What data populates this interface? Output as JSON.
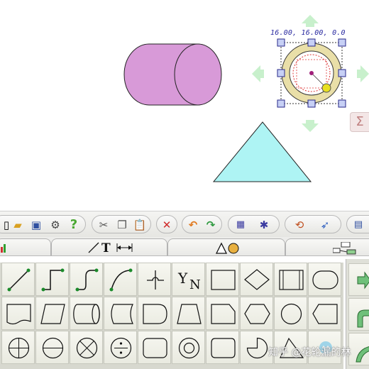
{
  "canvas": {
    "coordinate_readout": "16.00, 16.00, 0.0",
    "colors": {
      "cylinder": "#d89ad8",
      "triangle": "#aef4f4",
      "handles": "#c7d0f5",
      "ring": "#e9dfa8",
      "arrows": "#c8f0cc"
    }
  },
  "toolbar": {
    "icons": [
      "new-icon",
      "open-folder-icon",
      "save-icon",
      "settings-icon",
      "help-icon",
      "cut-icon",
      "copy-icon",
      "paste-icon",
      "delete-icon",
      "undo-icon",
      "redo-icon",
      "grid-icon",
      "snap-icon",
      "rotate-icon",
      "flip-icon",
      "align-icon"
    ]
  },
  "palette": {
    "tabs": [
      {
        "id": "charts",
        "icon": "bar-chart-icon"
      },
      {
        "id": "lines-text",
        "icon": "line-text-dimension-icon",
        "label": "T"
      },
      {
        "id": "shapes",
        "icon": "triangle-circle-icon"
      },
      {
        "id": "network",
        "icon": "network-icon"
      }
    ],
    "connector_text": "Y",
    "connector_sub": "N"
  },
  "watermark": "知乎 @花轮漏的林"
}
